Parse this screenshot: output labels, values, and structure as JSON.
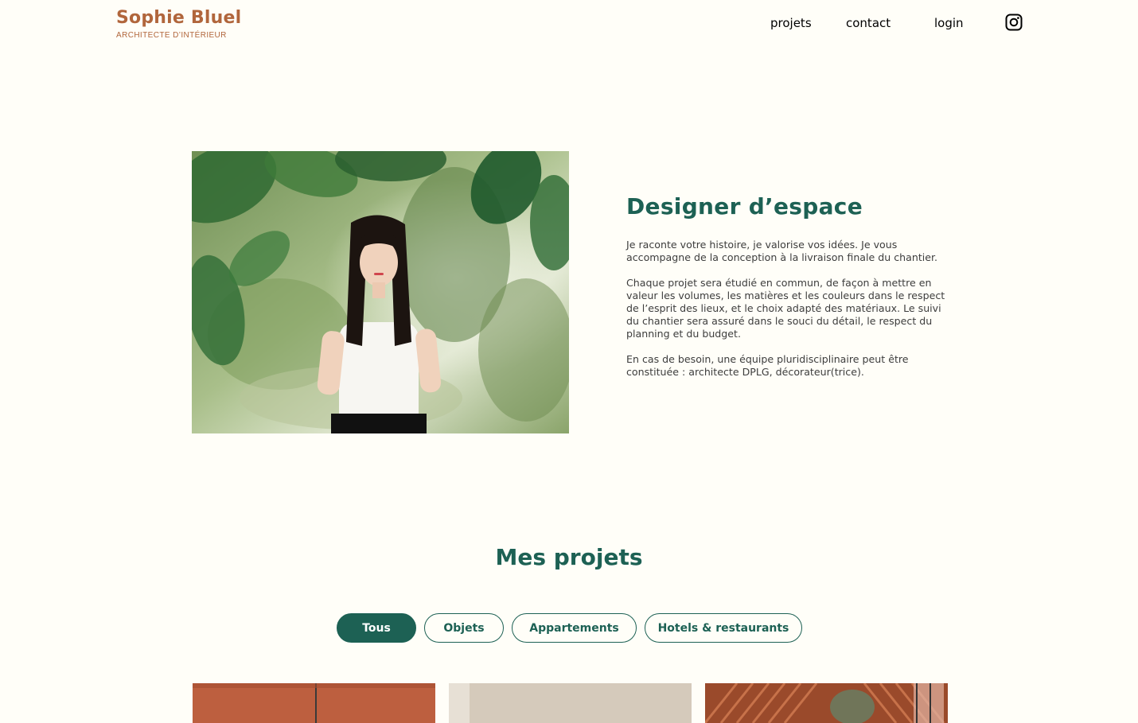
{
  "header": {
    "logo_name": "Sophie Bluel",
    "logo_tagline": "ARCHITECTE D’INTÉRIEUR",
    "nav": {
      "projets": "projets",
      "contact": "contact",
      "login": "login"
    },
    "social_icon": "instagram-icon"
  },
  "intro": {
    "title": "Designer d’espace",
    "paragraphs": [
      "Je raconte votre histoire, je valorise vos idées. Je vous accompagne de la conception à la livraison finale du chantier.",
      "Chaque projet sera étudié en commun, de façon à mettre en valeur les volumes, les matières et les couleurs dans le respect de l’esprit des lieux, et le choix adapté des matériaux. Le suivi du chantier sera assuré dans le souci du détail, le respect du planning et du budget.",
      "En cas de besoin, une équipe pluridisciplinaire peut être constituée : architecte DPLG, décorateur(trice)."
    ]
  },
  "projects": {
    "title": "Mes projets",
    "filters": [
      "Tous",
      "Objets",
      "Appartements",
      "Hotels & restaurants"
    ],
    "active_filter": "Tous"
  },
  "colors": {
    "background": "#fffef8",
    "brand_brown": "#b1663c",
    "brand_green": "#1d6154"
  }
}
